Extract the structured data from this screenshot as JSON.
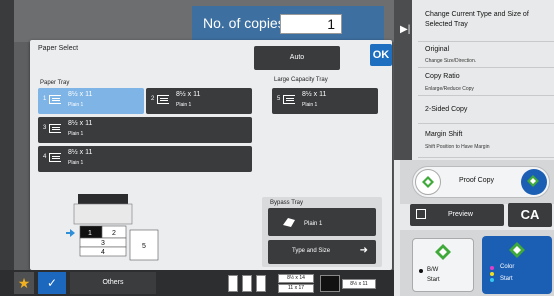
{
  "header": {
    "copies_label": "No. of copies",
    "copies_value": "1"
  },
  "dialog": {
    "title": "Paper Select",
    "auto_label": "Auto",
    "ok_label": "OK",
    "paper_tray_label": "Paper Tray",
    "large_capacity_label": "Large Capacity Tray",
    "bypass_label": "Bypass Tray",
    "type_and_size_label": "Type and Size",
    "trays": [
      {
        "num": "1",
        "size": "8½ x 11",
        "type": "Plain 1",
        "selected": true
      },
      {
        "num": "2",
        "size": "8½ x 11",
        "type": "Plain 1",
        "selected": false
      },
      {
        "num": "3",
        "size": "8½ x 11",
        "type": "Plain 1",
        "selected": false
      },
      {
        "num": "4",
        "size": "8½ x 11",
        "type": "Plain 1",
        "selected": false
      },
      {
        "num": "5",
        "size": "8½ x 11",
        "type": "Plain 1",
        "selected": false
      }
    ],
    "bypass_type": "Plain 1",
    "diagram_numbers": [
      "1",
      "2",
      "3",
      "4",
      "5"
    ]
  },
  "right_menu": [
    {
      "title": "Change Current Type and Size of Selected Tray",
      "sub": ""
    },
    {
      "title": "Original",
      "sub": "Change Size/Direction."
    },
    {
      "title": "Copy Ratio",
      "sub": "Enlarge/Reduce Copy"
    },
    {
      "title": "2-Sided Copy",
      "sub": ""
    },
    {
      "title": "Margin Shift",
      "sub": "Shift Position to Have Margin"
    }
  ],
  "right_buttons": {
    "proof_copy": "Proof Copy",
    "preview": "Preview",
    "ca": "CA",
    "bw": "B/W",
    "bw_start": "Start",
    "color": "Color",
    "color_start": "Start"
  },
  "bottom": {
    "others_label": "Others",
    "paper_sizes": [
      "8½ x 14",
      "11 x 17",
      "8½ x 11"
    ]
  },
  "colors": {
    "accent_blue": "#1f6fc0",
    "selected_tray": "#7fb5e6",
    "green_icon": "#3faa3a",
    "star": "#f0b020"
  }
}
